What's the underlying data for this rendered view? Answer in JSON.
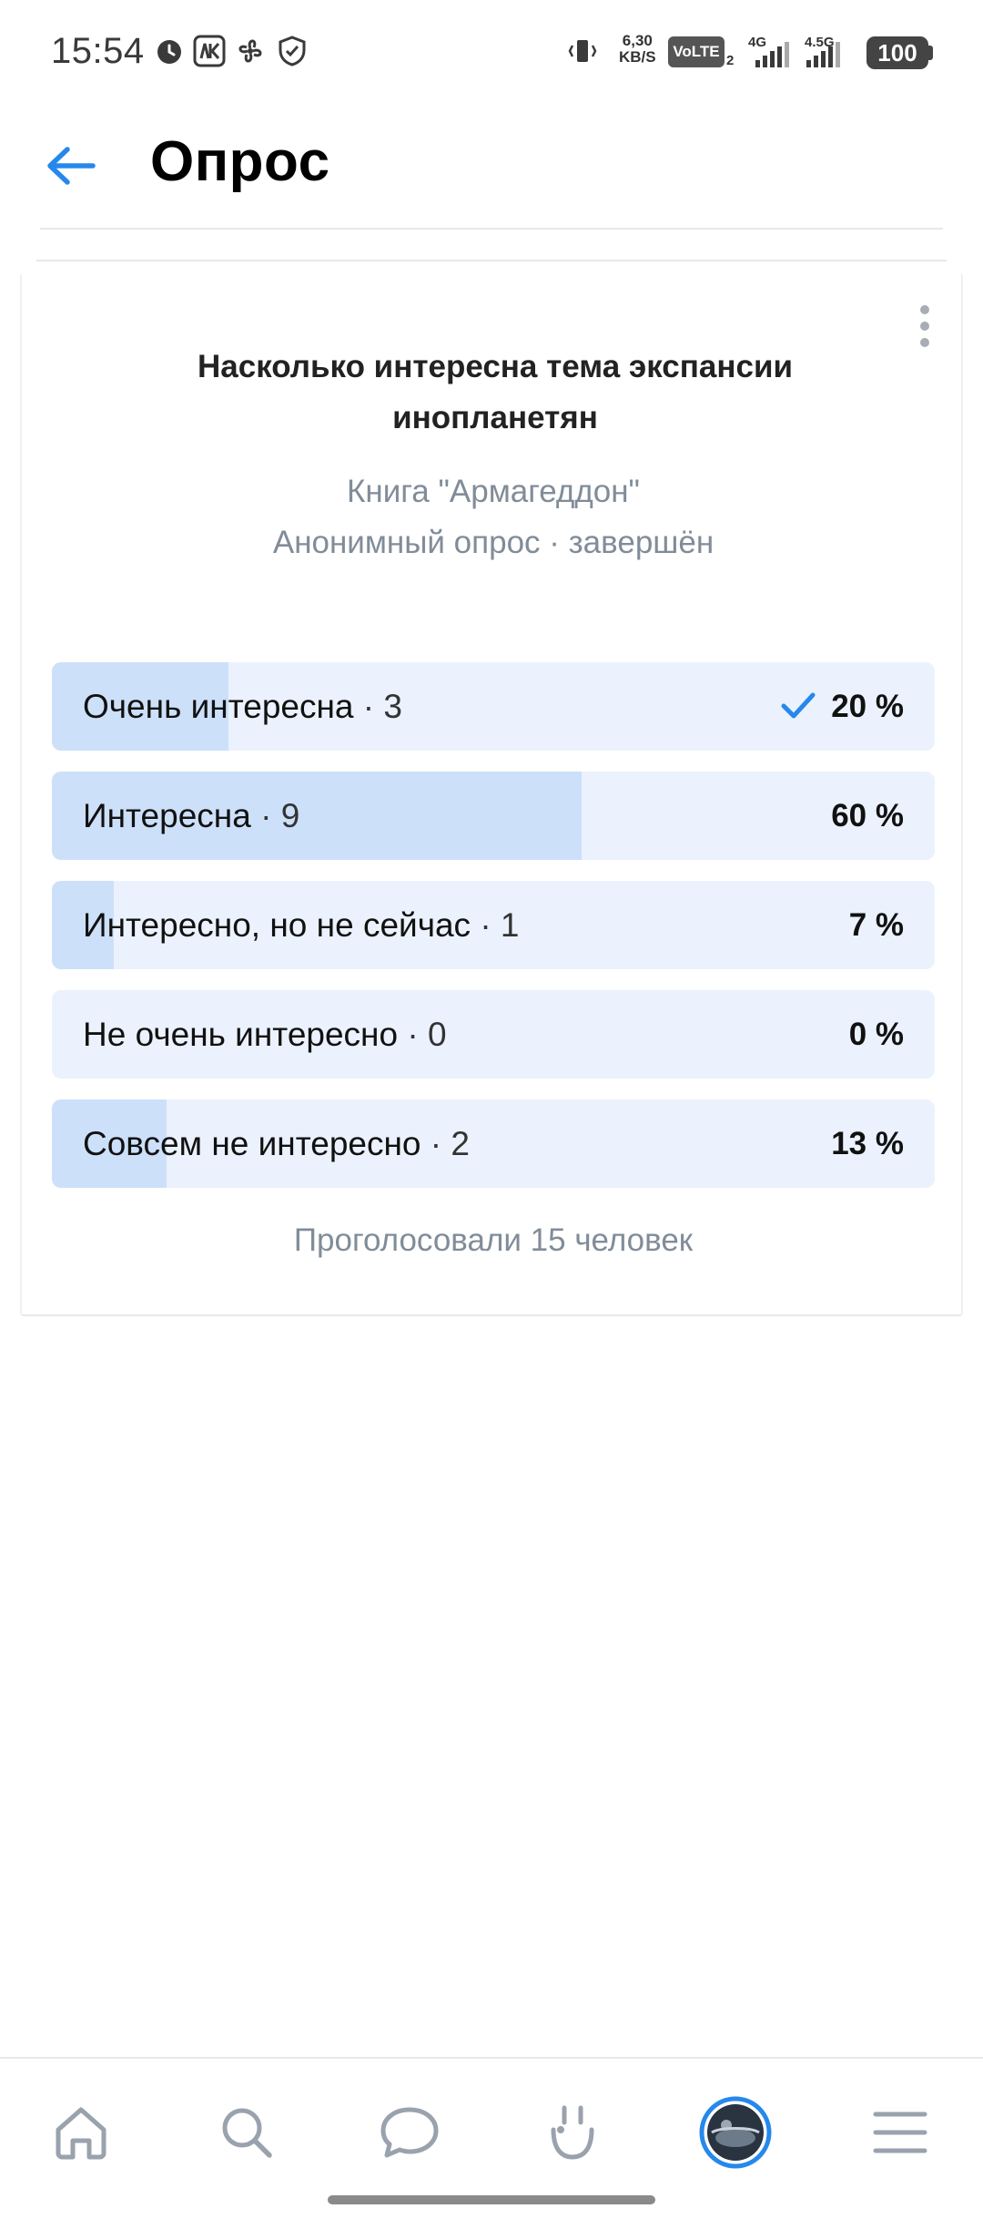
{
  "status_bar": {
    "time": "15:54",
    "speed_value": "6,30",
    "speed_unit": "KB/S",
    "volte": "VoLTE",
    "volte_sub": "2",
    "net1": "4G",
    "net2": "4.5G",
    "battery": "100"
  },
  "header": {
    "title": "Опрос"
  },
  "poll": {
    "question": "Насколько интересна тема экспансии инопланетян",
    "source": "Книга \"Армагеддон\"",
    "meta": "Анонимный опрос · завершён",
    "options": [
      {
        "label": "Очень интересна",
        "count": "· 3",
        "percent": "20 %",
        "fraction": 0.2,
        "voted": true
      },
      {
        "label": "Интересна",
        "count": "· 9",
        "percent": "60 %",
        "fraction": 0.6,
        "voted": false
      },
      {
        "label": "Интересно, но не сейчас",
        "count": "· 1",
        "percent": "7 %",
        "fraction": 0.07,
        "voted": false
      },
      {
        "label": "Не очень интересно",
        "count": "· 0",
        "percent": "0 %",
        "fraction": 0.0,
        "voted": false
      },
      {
        "label": "Совсем не интересно",
        "count": "· 2",
        "percent": "13 %",
        "fraction": 0.13,
        "voted": false
      }
    ],
    "total_votes": "Проголосовали 15 человек"
  },
  "colors": {
    "accent": "#2688eb",
    "option_bg": "#ebf2fd",
    "option_fill": "#cde0fa",
    "secondary_text": "#818c99"
  },
  "bottom_nav": {
    "items": [
      "home-icon",
      "search-icon",
      "messages-icon",
      "clips-icon",
      "profile-avatar",
      "menu-icon"
    ]
  }
}
